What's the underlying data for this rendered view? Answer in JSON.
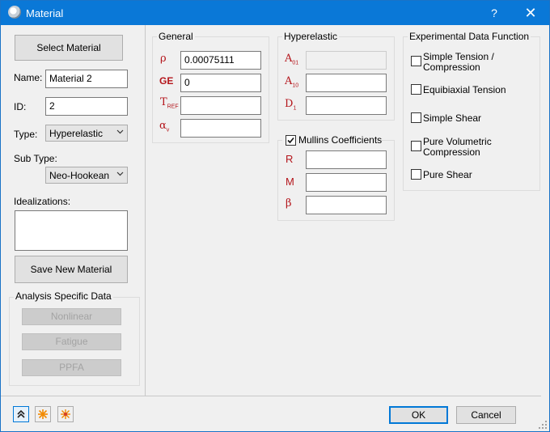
{
  "window": {
    "title": "Material",
    "help_label": "?",
    "close_label": "✕"
  },
  "left": {
    "select_material_label": "Select Material",
    "name_label": "Name:",
    "name_value": "Material 2",
    "id_label": "ID:",
    "id_value": "2",
    "type_label": "Type:",
    "type_value": "Hyperelastic",
    "subtype_label": "Sub Type:",
    "subtype_value": "Neo-Hookean",
    "idealizations_label": "Idealizations:",
    "idealizations_value": "",
    "save_new_label": "Save New Material"
  },
  "analysis": {
    "title": "Analysis Specific Data",
    "buttons": [
      "Nonlinear",
      "Fatigue",
      "PPFA"
    ]
  },
  "general": {
    "title": "General",
    "rows": [
      {
        "symbol": "ρ",
        "sub": "",
        "value": "0.00075111"
      },
      {
        "symbol": "GE",
        "sub": "",
        "value": "0"
      },
      {
        "symbol": "T",
        "sub": "REF",
        "value": ""
      },
      {
        "symbol": "α",
        "sub": "v",
        "value": ""
      }
    ]
  },
  "hyperelastic": {
    "title": "Hyperelastic",
    "rows": [
      {
        "symbol": "A",
        "sub": "01",
        "value": "",
        "disabled": true
      },
      {
        "symbol": "A",
        "sub": "10",
        "value": ""
      },
      {
        "symbol": "D",
        "sub": "1",
        "value": ""
      }
    ]
  },
  "mullins": {
    "title": "Mullins Coefficients",
    "checked": true,
    "rows": [
      {
        "symbol": "R",
        "value": ""
      },
      {
        "symbol": "M",
        "value": ""
      },
      {
        "symbol": "β",
        "value": ""
      }
    ]
  },
  "experimental": {
    "title": "Experimental Data Function",
    "items": [
      {
        "label_line1": "Simple Tension /",
        "label_line2": "Compression",
        "checked": false
      },
      {
        "label_line1": "Equibiaxial Tension",
        "label_line2": "",
        "checked": false
      },
      {
        "label_line1": "Simple Shear",
        "label_line2": "",
        "checked": false
      },
      {
        "label_line1": "Pure Volumetric",
        "label_line2": "Compression",
        "checked": false
      },
      {
        "label_line1": "Pure Shear",
        "label_line2": "",
        "checked": false
      }
    ]
  },
  "footer": {
    "ok_label": "OK",
    "cancel_label": "Cancel",
    "icons": [
      "collapse-up-icon",
      "sparkle-icon",
      "sparkle-multi-icon"
    ]
  },
  "colors": {
    "titlebar": "#0a78d7",
    "symbol": "#b4151b",
    "accent": "#0078d7"
  }
}
